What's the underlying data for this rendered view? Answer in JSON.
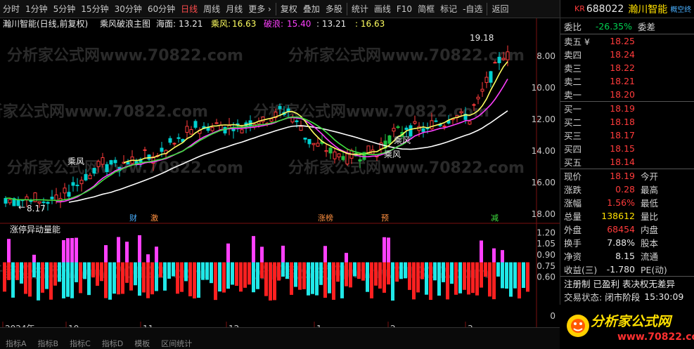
{
  "toolbar": {
    "items": [
      "分时",
      "1分钟",
      "5分钟",
      "15分钟",
      "30分钟",
      "60分钟",
      "日线",
      "周线",
      "月线",
      "更多 ›",
      "复权",
      "叠加",
      "多股",
      "统计",
      "画线",
      "F10",
      "简框",
      "标记",
      "-自选",
      "返回"
    ],
    "active": "日线"
  },
  "header": {
    "stock": "瀚川智能(日线,前复权)",
    "indicator": "乘风破浪主图",
    "hai_label": "海面:",
    "hai_value": "13.21",
    "cf_label": "乘风:",
    "cf_value": "16.63",
    "pl_label": "破浪:",
    "pl_value": "15.40",
    "v4": ": 13.21",
    "v5": ": 16.63"
  },
  "watermark": "分析家公式网www.70822.com",
  "main_chart": {
    "y_ticks": [
      "18.00",
      "16.00",
      "14.00",
      "12.00",
      "10.00",
      "8.00"
    ],
    "annotations": {
      "high": "19.18",
      "low": "8.17",
      "chengfeng": "乘风"
    },
    "event_markers": [
      "财",
      "激",
      "涨榜",
      "预",
      "减"
    ]
  },
  "sub_chart": {
    "title": "涨停异动量能",
    "y_ticks": [
      "1.20",
      "1.05",
      "0.90",
      "0.75",
      "0.60",
      "0"
    ]
  },
  "x_ticks": [
    "2024年",
    "10",
    "11",
    "12",
    "1",
    "2",
    "3"
  ],
  "quote": {
    "code": "688022",
    "name": "瀚川智能",
    "market_tag": "KR",
    "ext_tag": "概空终",
    "weibi_label": "委比",
    "weibi_value": "-26.35%",
    "weicha_label": "委差",
    "asks": [
      {
        "label": "卖五 ¥",
        "price": "18.25"
      },
      {
        "label": "卖四",
        "price": "18.24"
      },
      {
        "label": "卖三",
        "price": "18.22"
      },
      {
        "label": "卖二",
        "price": "18.21"
      },
      {
        "label": "卖一",
        "price": "18.20"
      }
    ],
    "bids": [
      {
        "label": "买一",
        "price": "18.19"
      },
      {
        "label": "买二",
        "price": "18.18"
      },
      {
        "label": "买三",
        "price": "18.17"
      },
      {
        "label": "买四",
        "price": "18.15"
      },
      {
        "label": "买五",
        "price": "18.14"
      }
    ],
    "stats": [
      {
        "l1": "现价",
        "v": "18.19",
        "c": "red",
        "l2": "今开"
      },
      {
        "l1": "涨跌",
        "v": "0.28",
        "c": "red",
        "l2": "最高"
      },
      {
        "l1": "涨幅",
        "v": "1.56%",
        "c": "red",
        "l2": "最低"
      },
      {
        "l1": "总量",
        "v": "138612",
        "c": "yellow",
        "l2": "量比"
      },
      {
        "l1": "外盘",
        "v": "68454",
        "c": "red",
        "l2": "内盘"
      },
      {
        "l1": "换手",
        "v": "7.88%",
        "c": "white",
        "l2": "股本"
      },
      {
        "l1": "净资",
        "v": "8.15",
        "c": "white",
        "l2": "流通"
      },
      {
        "l1": "收益(三)",
        "v": "-1.780",
        "c": "white",
        "l2": "PE(动)"
      }
    ],
    "info1": "注册制  已盈利  表决权无差异",
    "info2_label": "交易状态:",
    "info2_value": "闭市阶段",
    "info2_time": "15:30:09"
  },
  "bottom": {
    "items": [
      "指标A",
      "指标B",
      "指标C",
      "指标D",
      "模板",
      "区间统计"
    ]
  },
  "logo": {
    "text": "分析家公式网",
    "url": "www.70822.com"
  },
  "colors": {
    "up": "#ff3b3b",
    "down": "#00d0d0",
    "ma_long": "#ffffff",
    "ma_mid": "#ff40ff",
    "ma_short": "#ffff60",
    "ma_green": "#40e040",
    "vol_pink": "#ff40ff",
    "vol_red": "#ff2020",
    "vol_cyan": "#20e8e8"
  },
  "chart_data": [
    {
      "type": "candlestick",
      "title": "乘风破浪主图",
      "ylim": [
        7.5,
        19.5
      ],
      "y_ticks": [
        8,
        10,
        12,
        14,
        16,
        18
      ],
      "series_last": {
        "海面": 13.21,
        "乘风": 16.63,
        "破浪": 15.4
      },
      "high": 19.18,
      "low": 8.17
    },
    {
      "type": "bar",
      "title": "涨停异动量能",
      "ylim": [
        0,
        1.25
      ],
      "y_ticks": [
        0,
        0.6,
        0.75,
        0.9,
        1.05,
        1.2
      ]
    }
  ]
}
